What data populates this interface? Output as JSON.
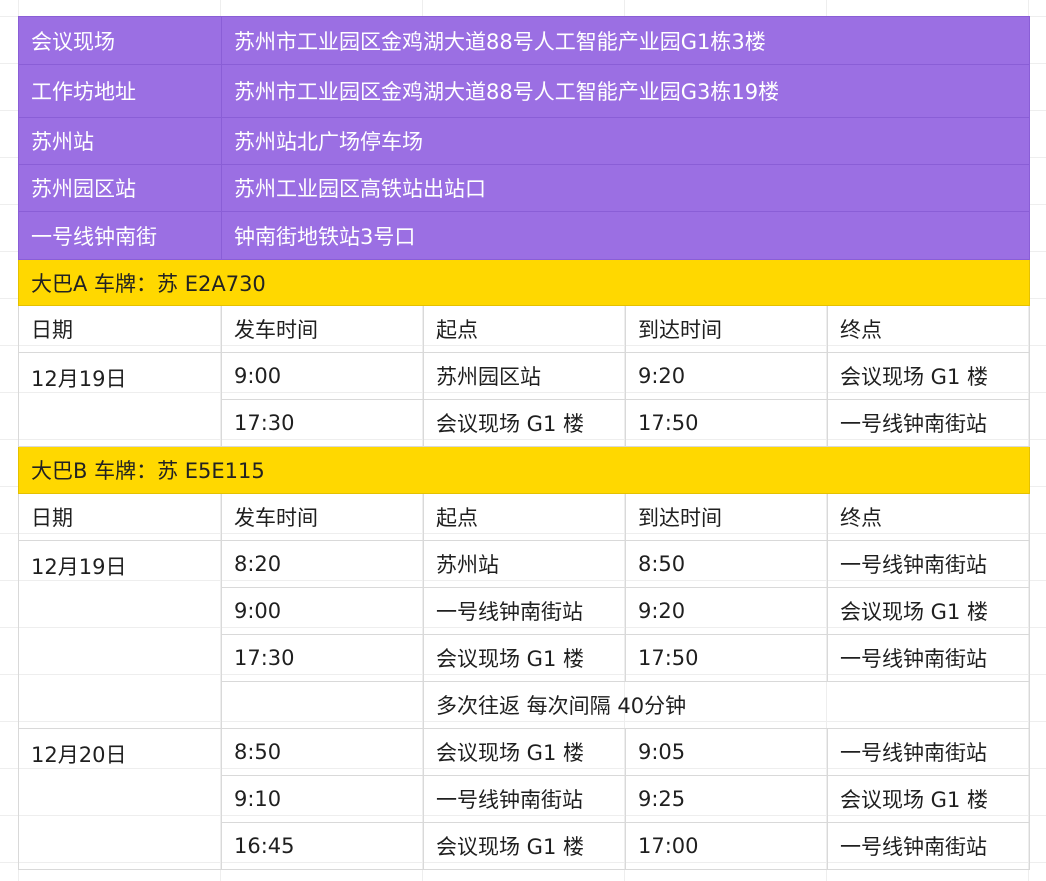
{
  "info": [
    {
      "label": "会议现场",
      "value": "苏州市工业园区金鸡湖大道88号人工智能产业园G1栋3楼"
    },
    {
      "label": "工作坊地址",
      "value": "苏州市工业园区金鸡湖大道88号人工智能产业园G3栋19楼"
    },
    {
      "label": "苏州站",
      "value": "苏州站北广场停车场"
    },
    {
      "label": "苏州园区站",
      "value": "苏州工业园区高铁站出站口"
    },
    {
      "label": "一号线钟南街",
      "value": "钟南街地铁站3号口"
    }
  ],
  "headers": [
    "日期",
    "发车时间",
    "起点",
    "到达时间",
    "终点"
  ],
  "busA": {
    "title": "大巴A  车牌：苏 E2A730",
    "date": "12月19日",
    "rows": [
      [
        "9:00",
        "苏州园区站",
        "9:20",
        "会议现场 G1 楼"
      ],
      [
        "17:30",
        "会议现场 G1 楼",
        "17:50",
        "一号线钟南街站"
      ]
    ]
  },
  "busB": {
    "title": "大巴B 车牌：苏 E5E115",
    "date1": "12月19日",
    "rows1": [
      [
        "8:20",
        "苏州站",
        "8:50",
        "一号线钟南街站"
      ],
      [
        "9:00",
        "一号线钟南街站",
        "9:20",
        "会议现场 G1 楼"
      ],
      [
        "17:30",
        "会议现场 G1 楼",
        "17:50",
        "一号线钟南街站"
      ]
    ],
    "note": "多次往返 每次间隔 40分钟",
    "date2": "12月20日",
    "rows2": [
      [
        "8:50",
        "会议现场 G1 楼",
        "9:05",
        "一号线钟南街站"
      ],
      [
        "9:10",
        "一号线钟南街站",
        "9:25",
        "会议现场 G1 楼"
      ],
      [
        "16:45",
        "会议现场 G1 楼",
        "17:00",
        "一号线钟南街站"
      ]
    ]
  }
}
